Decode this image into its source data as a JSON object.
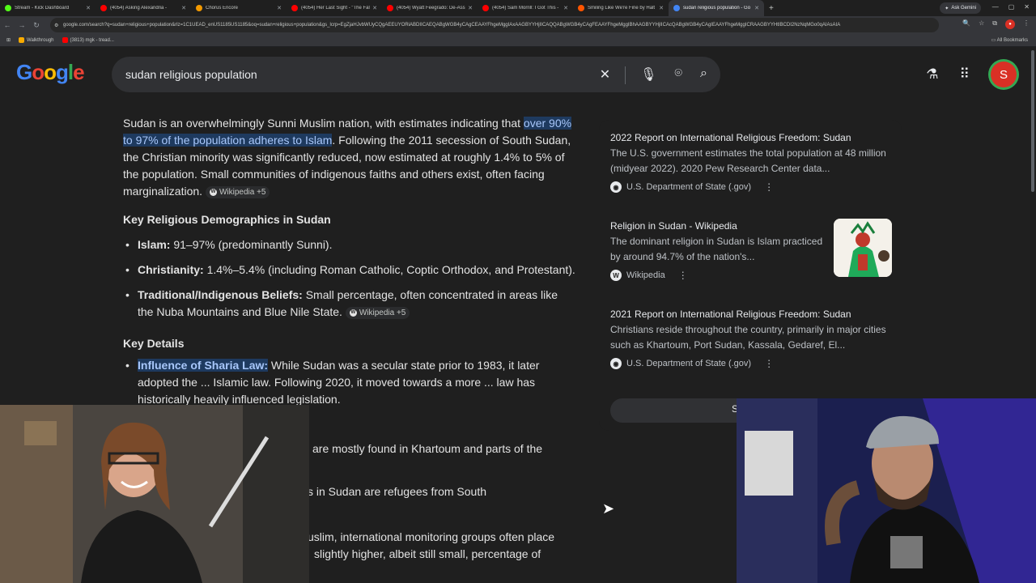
{
  "browser": {
    "tabs": [
      {
        "label": "Stream - Kick Dashboard",
        "color": "#53fc18",
        "active": false
      },
      {
        "label": "(4054) Asking Alexandria -",
        "color": "#ff0000",
        "active": false
      },
      {
        "label": "Chorus Encore",
        "color": "#f29900",
        "active": false
      },
      {
        "label": "(4054) Her Last Sight - \"The Fal",
        "color": "#ff0000",
        "active": false
      },
      {
        "label": "(4054) Wyatt Feegrado: De-Ass",
        "color": "#ff0000",
        "active": false
      },
      {
        "label": "(4054) Sam Morrill: I Got This -",
        "color": "#ff0000",
        "active": false
      },
      {
        "label": "Smiling Like We're Fine by Halt",
        "color": "#ff5500",
        "active": false
      },
      {
        "label": "sudan religious population - Go",
        "color": "#4285f4",
        "active": true
      }
    ],
    "new_tab": "+",
    "ask_gemini": "Ask Gemini",
    "url": "google.com/search?q=sudan+religious+population&rlz=1C1UEAD_enUS1185US1185&oq=sudan+religious+population&gs_lcrp=EgZjaHJvbWUyCQgAEEUYORiABDIICAEQABgWGB4yCAgCEAAYFhgeMggIAxAAGBYYHjIICAQQABgWGB4yCAgFEAAYFhgeMggIBhAAGBYYHjIICAcQABgWGB4yCAgIEAAYFhgeMggICRAAGBYYHtIBCDI2NzNqMGo0qAIAsAIA",
    "bookmarks": [
      {
        "label": "Walkthrough",
        "color": "#f9ab00"
      },
      {
        "label": "(3813) mgk - tread...",
        "color": "#ff0000"
      }
    ],
    "all_bookmarks": "All Bookmarks"
  },
  "google": {
    "logo": "Google",
    "query": "sudan religious population",
    "avatar_letter": "S"
  },
  "answer": {
    "intro_pre": "Sudan is an overwhelmingly Sunni Muslim nation, with estimates indicating that ",
    "intro_hl": "over 90% to 97% of the population adheres to Islam",
    "intro_post": ". Following the 2011 secession of South Sudan, the Christian minority was significantly reduced, now estimated at roughly 1.4% to 5% of the population. Small communities of indigenous faiths and others exist, often facing marginalization.",
    "chip1": "Wikipedia +5",
    "h_demographics": "Key Religious Demographics in Sudan",
    "demographics": [
      {
        "term": "Islam:",
        "text": " 91–97% (predominantly Sunni)."
      },
      {
        "term": "Christianity:",
        "text": " 1.4%–5.4% (including Roman Catholic, Coptic Orthodox, and Protestant)."
      },
      {
        "term": "Traditional/Indigenous Beliefs:",
        "text": " Small percentage, often concentrated in areas like the Nuba Mountains and Blue Nile State."
      }
    ],
    "chip2": "Wikipedia +5",
    "h_details": "Key Details",
    "sharia_term": "Influence of Sharia Law:",
    "sharia_text": " While Sudan was a secular state prior to 1983, it later adopted the ... Islamic law. Following 2020, it moved towards a more ... law has historically heavily influenced legislation.",
    "line_khartoum": "are mostly found in Khartoum and parts of the",
    "line_refugees": "s in Sudan are refugees from South",
    "line_monitoring": "uslim, international monitoring groups often place",
    "line_higher": "slightly higher, albeit still small, percentage of"
  },
  "sources": [
    {
      "title": "2022 Report on International Religious Freedom: Sudan",
      "desc": "The U.S. government estimates the total population at 48 million (midyear 2022). 2020 Pew Research Center data...",
      "site": "U.S. Department of State (.gov)",
      "icon": "seal-icon"
    },
    {
      "title": "Religion in Sudan - Wikipedia",
      "desc": "The dominant religion in Sudan is Islam practiced by around 94.7% of the nation's...",
      "site": "Wikipedia",
      "icon": "wikipedia-icon"
    },
    {
      "title": "2021 Report on International Religious Freedom: Sudan",
      "desc": "Christians reside throughout the country, primarily in major cities such as Khartoum, Port Sudan, Kassala, Gedaref, El...",
      "site": "U.S. Department of State (.gov)",
      "icon": "seal-icon"
    }
  ],
  "show_all_label": "S"
}
